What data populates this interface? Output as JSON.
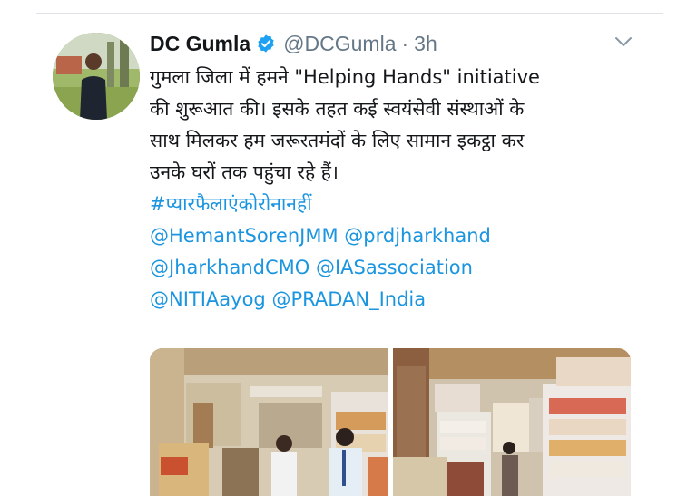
{
  "tweet": {
    "author_name": "DC Gumla",
    "author_handle": "@DCGumla",
    "separator": "·",
    "time": "3h",
    "text_lines": [
      "गुमला जिला में हमने \"Helping Hands\" initiative",
      "की शुरूआत की। इसके तहत कई स्वयंसेवी संस्थाओं के",
      "साथ मिलकर हम जरूरतमंदों के लिए सामान इकट्ठा कर",
      "उनके घरों तक पहुंचा रहे हैं।"
    ],
    "hashtag": "#प्यारफैलाएंकोरोनानहीं",
    "mentions": [
      [
        "@HemantSorenJMM",
        "@prdjharkhand"
      ],
      [
        "@JharkhandCMO",
        "@IASassociation"
      ],
      [
        "@NITIAayog",
        "@PRADAN_India"
      ]
    ]
  },
  "icons": {
    "verified": "verified-badge-icon",
    "more": "chevron-down-icon"
  },
  "colors": {
    "link": "#1b95e0",
    "text": "#14171a",
    "muted": "#657786",
    "verified": "#1da1f2"
  }
}
